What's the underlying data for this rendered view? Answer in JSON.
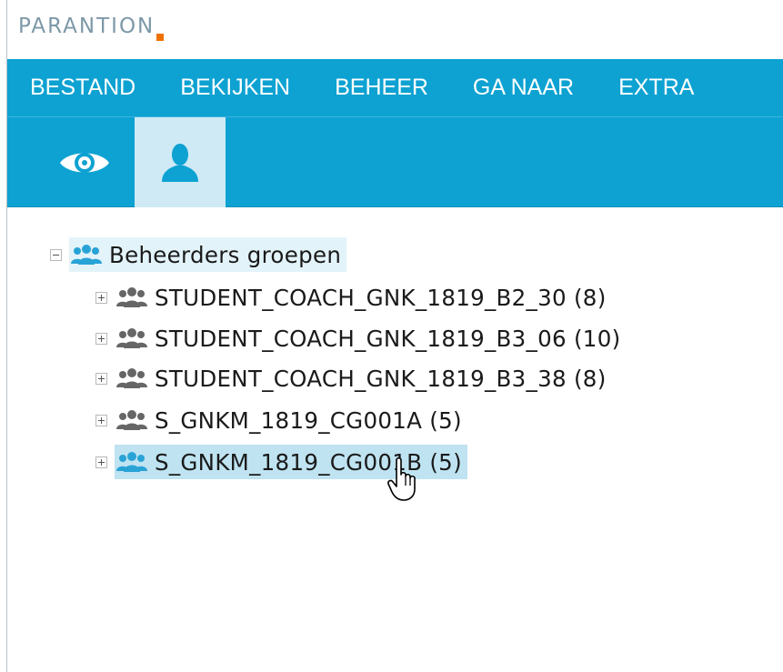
{
  "logo": {
    "text": "PARANTION"
  },
  "menu": {
    "items": [
      {
        "label": "BESTAND"
      },
      {
        "label": "BEKIJKEN"
      },
      {
        "label": "BEHEER"
      },
      {
        "label": "GA NAAR"
      },
      {
        "label": "EXTRA"
      }
    ]
  },
  "toolbar": {
    "buttons": [
      {
        "icon": "eye-icon",
        "active": false
      },
      {
        "icon": "user-icon",
        "active": true
      }
    ]
  },
  "tree": {
    "root": {
      "label": "Beheerders groepen",
      "expanded": true
    },
    "children": [
      {
        "label": "STUDENT_COACH_GNK_1819_B2_30 (8)",
        "selected": false
      },
      {
        "label": "STUDENT_COACH_GNK_1819_B3_06 (10)",
        "selected": false
      },
      {
        "label": "STUDENT_COACH_GNK_1819_B3_38 (8)",
        "selected": false
      },
      {
        "label": "S_GNKM_1819_CG001A (5)",
        "selected": false
      },
      {
        "label": "S_GNKM_1819_CG001B (5)",
        "selected": true
      }
    ]
  },
  "colors": {
    "brand_blue": "#0da2d2",
    "logo_grey": "#7d98a8",
    "logo_accent": "#ee7203",
    "active_tab": "#cfeaf5",
    "selected_row": "#bfe3f1",
    "group_icon_blue": "#29a3d6",
    "group_icon_grey": "#666666"
  }
}
